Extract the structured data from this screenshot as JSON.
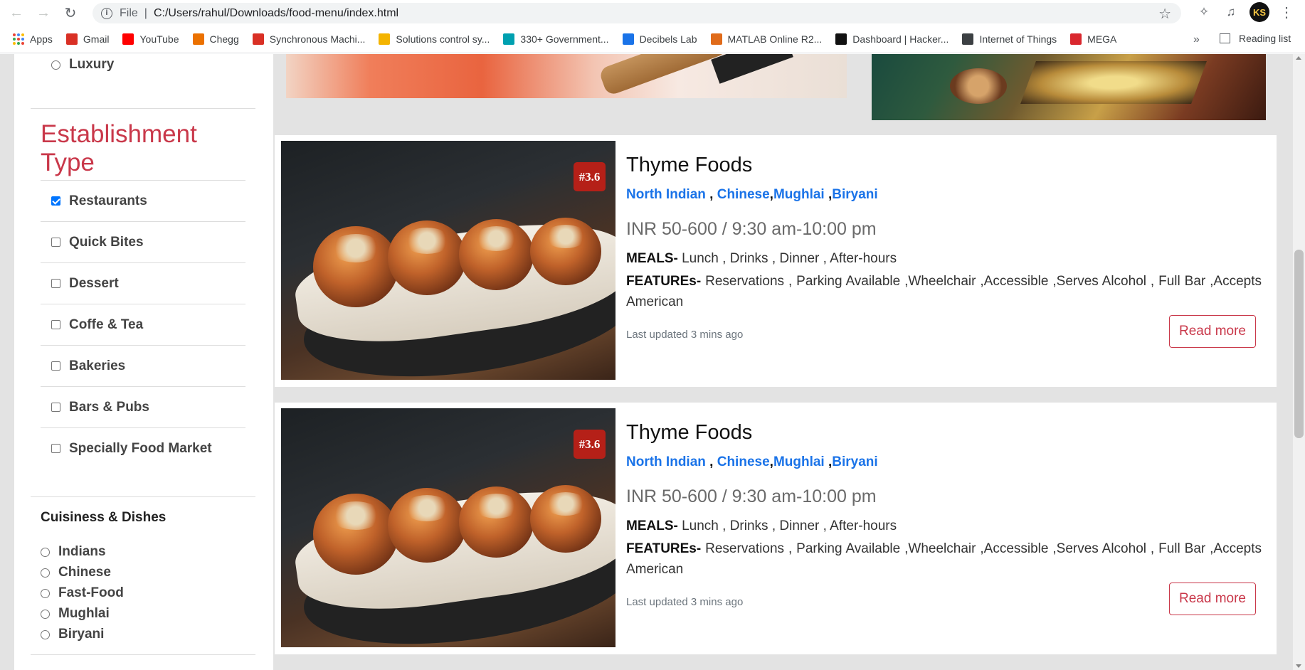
{
  "browser": {
    "scheme": "File",
    "url": "C:/Users/rahul/Downloads/food-menu/index.html",
    "bookmarks": [
      {
        "label": "Apps",
        "icon": "apps-grid-icon"
      },
      {
        "label": "Gmail",
        "icon": "gmail-icon",
        "color": "#d93025"
      },
      {
        "label": "YouTube",
        "icon": "youtube-icon",
        "color": "#ff0000"
      },
      {
        "label": "Chegg",
        "icon": "chegg-icon",
        "color": "#eb7100"
      },
      {
        "label": "Synchronous Machi...",
        "icon": "chegg-c-icon",
        "color": "#d93025"
      },
      {
        "label": "Solutions control sy...",
        "icon": "drive-icon",
        "color": "#f4b400"
      },
      {
        "label": "330+ Government...",
        "icon": "bookmark-site-icon",
        "color": "#00a0b0"
      },
      {
        "label": "Decibels Lab",
        "icon": "doc-icon",
        "color": "#1a73e8"
      },
      {
        "label": "MATLAB Online R2...",
        "icon": "matlab-icon",
        "color": "#e06b1a"
      },
      {
        "label": "Dashboard | Hacker...",
        "icon": "hackerrank-icon",
        "color": "#111111"
      },
      {
        "label": "Internet of Things",
        "icon": "iot-icon",
        "color": "#3c4043"
      },
      {
        "label": "MEGA",
        "icon": "mega-icon",
        "color": "#d9272e"
      }
    ],
    "more": "»",
    "reading_list": "Reading list",
    "profile_initials": "KS"
  },
  "sidebar": {
    "luxury_label": "Luxury",
    "establishment_title": "Establishment Type",
    "establishment_items": [
      {
        "label": "Restaurants",
        "checked": true
      },
      {
        "label": "Quick Bites",
        "checked": false
      },
      {
        "label": "Dessert",
        "checked": false
      },
      {
        "label": "Coffe & Tea",
        "checked": false
      },
      {
        "label": "Bakeries",
        "checked": false
      },
      {
        "label": "Bars & Pubs",
        "checked": false
      },
      {
        "label": "Specially Food Market",
        "checked": false
      }
    ],
    "cuisine_title": "Cuisiness & Dishes",
    "cuisine_items": [
      "Indians",
      "Chinese",
      "Fast-Food",
      "Mughlai",
      "Biryani"
    ]
  },
  "cards": [
    {
      "rating": "#3.6",
      "title": "Thyme Foods",
      "cuisines": [
        "North Indian",
        "Chinese",
        "Mughlai",
        "Biryani"
      ],
      "price": "INR 50-600 / 9:30 am-10:00 pm",
      "meals_label": "MEALS-",
      "meals": " Lunch , Drinks , Dinner , After-hours",
      "features_label": "FEATUREs-",
      "features": " Reservations , Parking Available ,Wheelchair ,Accessible ,Serves Alcohol , Full Bar ,Accepts American",
      "updated": "Last updated 3 mins ago",
      "button": "Read more"
    },
    {
      "rating": "#3.6",
      "title": "Thyme Foods",
      "cuisines": [
        "North Indian",
        "Chinese",
        "Mughlai",
        "Biryani"
      ],
      "price": "INR 50-600 / 9:30 am-10:00 pm",
      "meals_label": "MEALS-",
      "meals": " Lunch , Drinks , Dinner , After-hours",
      "features_label": "FEATUREs-",
      "features": " Reservations , Parking Available ,Wheelchair ,Accessible ,Serves Alcohol , Full Bar ,Accepts American",
      "updated": "Last updated 3 mins ago",
      "button": "Read more"
    }
  ],
  "colors": {
    "accent_red": "#c9384a",
    "link_blue": "#1a73e8",
    "badge_red": "#b52018"
  }
}
